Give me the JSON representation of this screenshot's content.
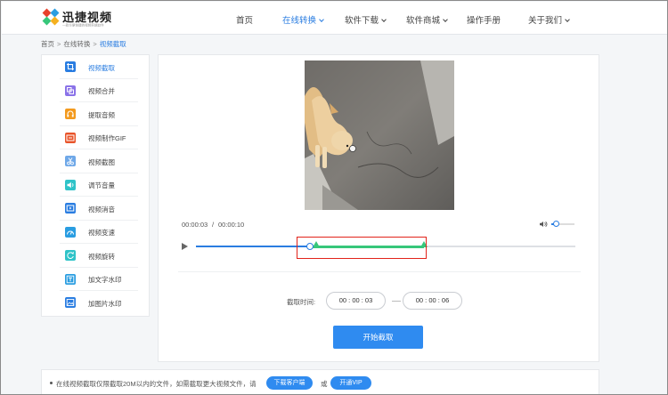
{
  "brand": {
    "name": "迅捷视频",
    "tagline": "一款方便快捷的视频剪辑软件"
  },
  "nav": {
    "items": [
      {
        "label": "首页",
        "has_caret": false,
        "active": false
      },
      {
        "label": "在线转换",
        "has_caret": true,
        "active": true
      },
      {
        "label": "软件下载",
        "has_caret": true,
        "active": false
      },
      {
        "label": "软件商城",
        "has_caret": true,
        "active": false
      },
      {
        "label": "操作手册",
        "has_caret": false,
        "active": false
      },
      {
        "label": "关于我们",
        "has_caret": true,
        "active": false
      }
    ]
  },
  "breadcrumb": {
    "items": [
      "首页",
      "在线转换",
      "视频截取"
    ],
    "separator": ">"
  },
  "sidebar": {
    "items": [
      {
        "label": "视频截取",
        "icon": "crop-icon",
        "color": "#2a7de1",
        "active": true
      },
      {
        "label": "视频合并",
        "icon": "merge-icon",
        "color": "#8a72e8",
        "active": false
      },
      {
        "label": "提取音频",
        "icon": "headphones-icon",
        "color": "#f39a1e",
        "active": false
      },
      {
        "label": "视频制作GIF",
        "icon": "gif-icon",
        "color": "#e8542a",
        "active": false
      },
      {
        "label": "视频截图",
        "icon": "scissors-icon",
        "color": "#6fa8e8",
        "active": false
      },
      {
        "label": "调节音量",
        "icon": "volume-icon",
        "color": "#2fc3c8",
        "active": false
      },
      {
        "label": "视频消音",
        "icon": "video-mute-icon",
        "color": "#2a7de1",
        "active": false
      },
      {
        "label": "视频变速",
        "icon": "speed-icon",
        "color": "#2a9de1",
        "active": false
      },
      {
        "label": "视频旋转",
        "icon": "rotate-icon",
        "color": "#2fc3c8",
        "active": false
      },
      {
        "label": "加文字水印",
        "icon": "text-watermark-icon",
        "color": "#2a9de1",
        "active": false
      },
      {
        "label": "加图片水印",
        "icon": "image-watermark-icon",
        "color": "#2a7de1",
        "active": false
      }
    ]
  },
  "player": {
    "current_time": "00:00:03",
    "separator": "/",
    "total_time": "00:00:10",
    "progress": 0.3,
    "volume": 0.08,
    "selection_start": 0.3,
    "selection_end": 0.6
  },
  "cut": {
    "label": "截取时间:",
    "start": "00 : 00 : 03",
    "end": "00 : 00 : 06",
    "button_label": "开始截取"
  },
  "notice": {
    "text": "在线视频截取仅限截取20M以内的文件，如需截取更大视频文件，请",
    "download_label": "下载客户端",
    "or": "或",
    "vip_label": "开通VIP"
  },
  "colors": {
    "accent": "#2a7de1",
    "selection": "#37c77a",
    "highlight_box": "#e2231a"
  }
}
